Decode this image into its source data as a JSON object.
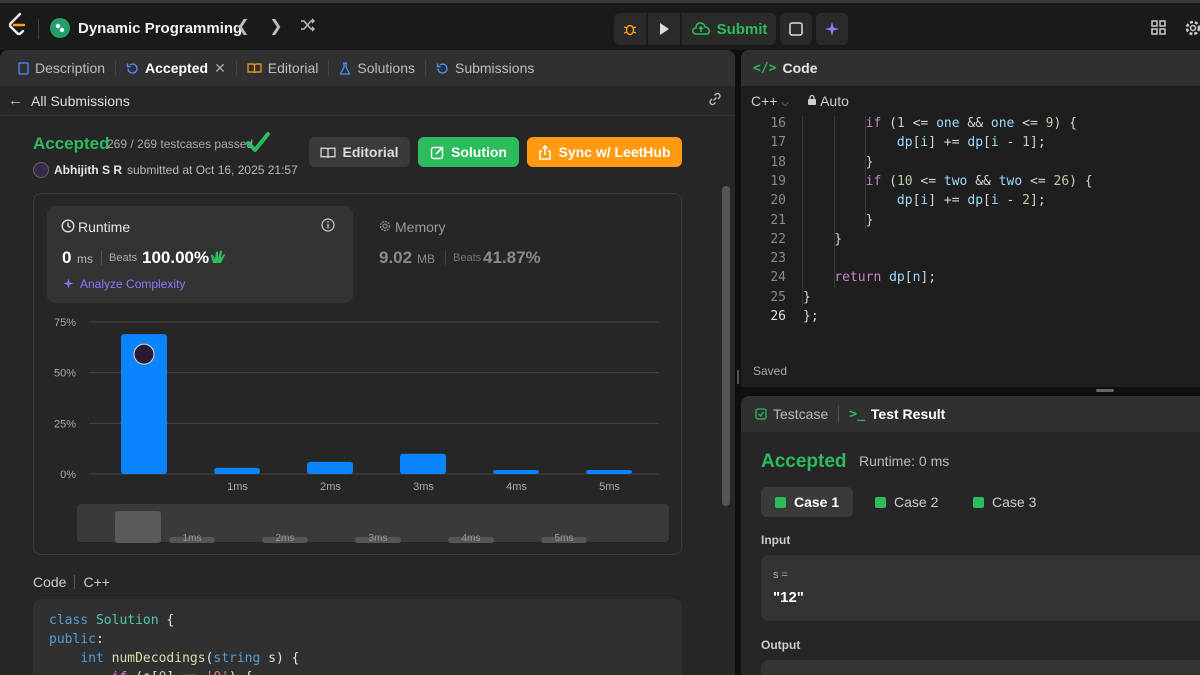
{
  "topbar": {
    "problem_title": "Dynamic Programming",
    "submit_label": "Submit"
  },
  "left_tabs": [
    {
      "label": "Description"
    },
    {
      "label": "Accepted"
    },
    {
      "label": "Editorial"
    },
    {
      "label": "Solutions"
    },
    {
      "label": "Submissions"
    }
  ],
  "subheader": {
    "back_label": "All Submissions"
  },
  "result": {
    "status": "Accepted",
    "testcases": "269 / 269 testcases passed",
    "user": "Abhijith S R",
    "submitted_text": "submitted at Oct 16, 2025 21:57",
    "editorial_btn": "Editorial",
    "solution_btn": "Solution",
    "sync_btn": "Sync w/ LeetHub"
  },
  "runtime": {
    "title": "Runtime",
    "value": "0",
    "unit": "ms",
    "beats_label": "Beats",
    "beats_value": "100.00%",
    "analyze": "Analyze Complexity"
  },
  "memory": {
    "title": "Memory",
    "value": "9.02",
    "unit": "MB",
    "beats_label": "Beats",
    "beats_value": "41.87%"
  },
  "chart_data": {
    "type": "bar",
    "categories": [
      "",
      "1ms",
      "2ms",
      "3ms",
      "4ms",
      "5ms"
    ],
    "values": [
      69,
      3,
      6,
      10,
      2,
      2
    ],
    "yticks": [
      "75%",
      "50%",
      "25%",
      "0%"
    ],
    "ylim": [
      0,
      75
    ],
    "grid": true,
    "highlight_index": 0,
    "bar_color": "#0a84ff",
    "mini_labels": [
      "1ms",
      "2ms",
      "3ms",
      "4ms",
      "5ms"
    ]
  },
  "code_section": {
    "label": "Code",
    "lang": "C++",
    "lines": [
      "class Solution {",
      "public:",
      "    int numDecodings(string s) {",
      "        if (s[0] == '0') {"
    ]
  },
  "editor": {
    "title": "Code",
    "lang": "C++",
    "mode": "Auto",
    "saved": "Saved",
    "line_numbers": [
      "16",
      "17",
      "18",
      "19",
      "20",
      "21",
      "22",
      "23",
      "24",
      "25",
      "26"
    ],
    "lines": [
      "            if (1 <= one && one <= 9) {",
      "                dp[i] += dp[i - 1];",
      "            }",
      "            if (10 <= two && two <= 26) {",
      "                dp[i] += dp[i - 2];",
      "            }",
      "        }",
      "",
      "        return dp[n];",
      "    }",
      "};"
    ]
  },
  "test_panel": {
    "testcase_tab": "Testcase",
    "result_tab": "Test Result",
    "status": "Accepted",
    "runtime": "Runtime: 0 ms",
    "cases": [
      "Case 1",
      "Case 2",
      "Case 3"
    ],
    "input_label": "Input",
    "var_name": "s =",
    "var_value": "\"12\"",
    "output_label": "Output"
  },
  "colors": {
    "accent_green": "#2cbb5d",
    "accent_orange": "#ffa116",
    "bar_blue": "#0a84ff"
  }
}
